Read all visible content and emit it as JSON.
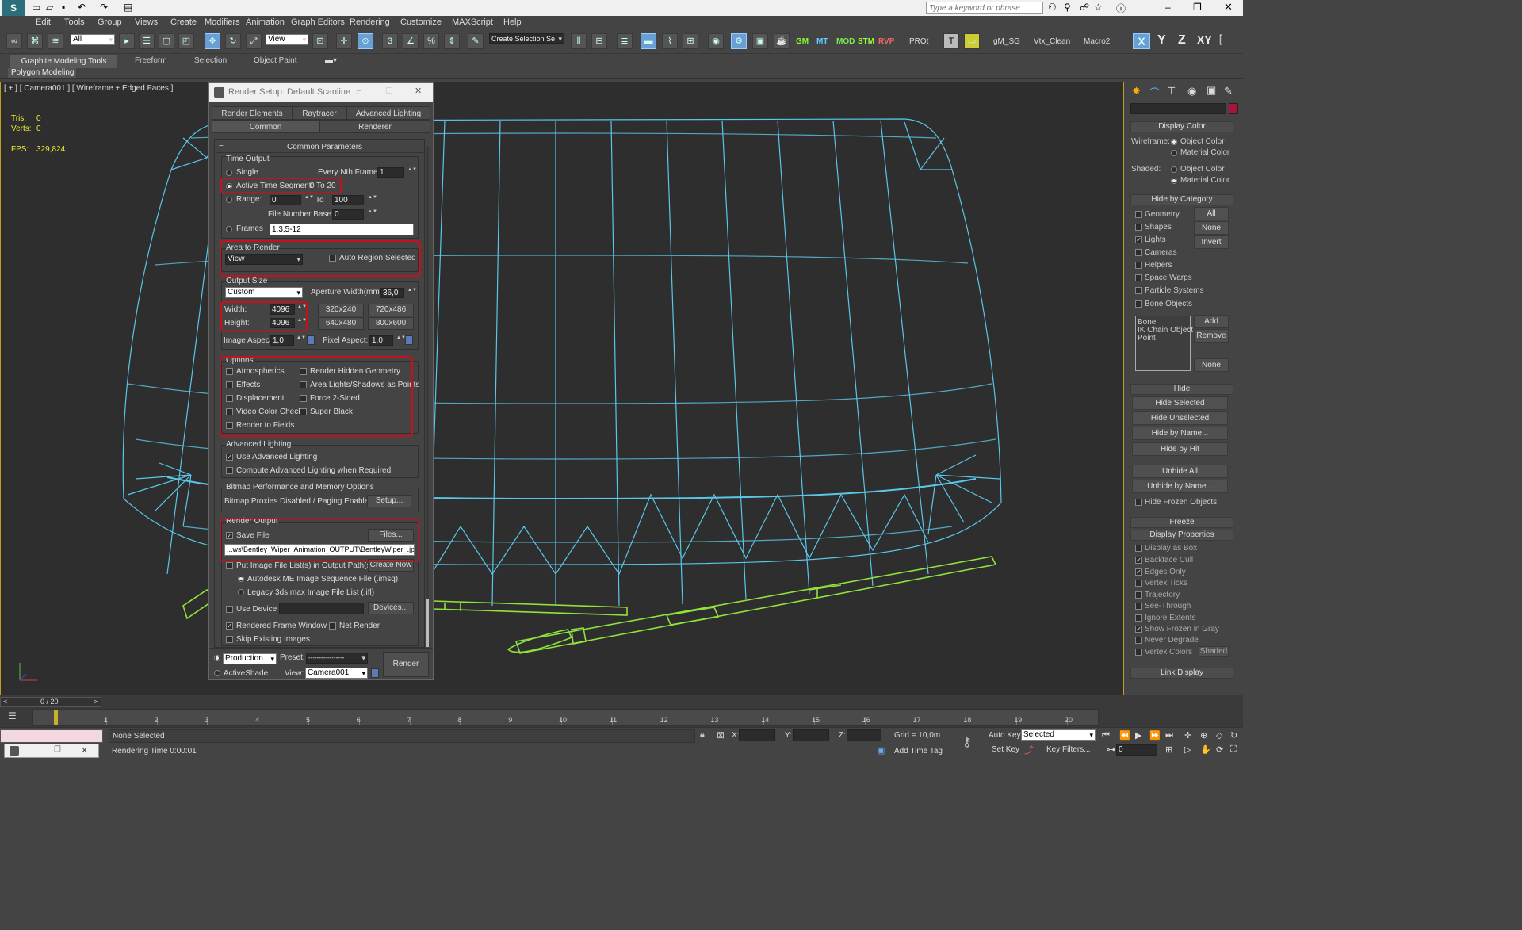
{
  "title_bar": {
    "search_placeholder": "Type a keyword or phrase"
  },
  "menu": [
    "Edit",
    "Tools",
    "Group",
    "Views",
    "Create",
    "Modifiers",
    "Animation",
    "Graph Editors",
    "Rendering",
    "Customize",
    "MAXScript",
    "Help"
  ],
  "toolbar": {
    "selection_filter": "All",
    "ref_coord": "View",
    "named_selection": "Create Selection Se",
    "script_labels": [
      "GM",
      "MT",
      "MOD",
      "STM",
      "RVP",
      "PROt",
      "gM_SG",
      "Vtx_Clean",
      "Macro2"
    ],
    "axis_labels": [
      "X",
      "Y",
      "Z",
      "XY"
    ]
  },
  "ribbon": {
    "tabs": [
      "Graphite Modeling Tools",
      "Freeform",
      "Selection",
      "Object Paint"
    ],
    "sub_label": "Polygon Modeling"
  },
  "viewport": {
    "label": "[ + ] [ Camera001 ] [ Wireframe + Edged Faces ]",
    "stats": {
      "tris_label": "Tris:",
      "tris": "0",
      "verts_label": "Verts:",
      "verts": "0",
      "fps_label": "FPS:",
      "fps": "329,824"
    },
    "colors": {
      "wire": "#5ac6e8",
      "wiper": "#8fe33c",
      "bg": "#2e2e2e"
    }
  },
  "dialog": {
    "title": "Render Setup: Default Scanline ...",
    "tabs_row1": [
      "Render Elements",
      "Raytracer",
      "Advanced Lighting"
    ],
    "tabs_row2": [
      "Common",
      "Renderer"
    ],
    "rollout": "Common Parameters",
    "time_output": {
      "label": "Time Output",
      "single": "Single",
      "every_nth_label": "Every Nth Frame:",
      "every_nth": "1",
      "active_segment": "Active Time Segment:",
      "active_segment_value": "0 To 20",
      "range": "Range:",
      "range_from": "0",
      "to": "To",
      "range_to": "100",
      "file_number_base_label": "File Number Base:",
      "file_number_base": "0",
      "frames": "Frames",
      "frames_value": "1,3,5-12"
    },
    "area": {
      "label": "Area to Render",
      "value": "View",
      "auto_region": "Auto Region Selected"
    },
    "output_size": {
      "label": "Output Size",
      "preset": "Custom",
      "aperture_label": "Aperture Width(mm):",
      "aperture": "36,0",
      "width_label": "Width:",
      "width": "4096",
      "height_label": "Height:",
      "height": "4096",
      "presets": [
        "320x240",
        "720x486",
        "640x480",
        "800x600"
      ],
      "image_aspect_label": "Image Aspect:",
      "image_aspect": "1,0",
      "pixel_aspect_label": "Pixel Aspect:",
      "pixel_aspect": "1,0"
    },
    "options": {
      "label": "Options",
      "left": [
        "Atmospherics",
        "Effects",
        "Displacement",
        "Video Color Check",
        "Render to Fields"
      ],
      "right": [
        "Render Hidden Geometry",
        "Area Lights/Shadows as Points",
        "Force 2-Sided",
        "Super Black"
      ]
    },
    "advanced_lighting": {
      "label": "Advanced Lighting",
      "use": "Use Advanced Lighting",
      "compute": "Compute Advanced Lighting when Required"
    },
    "bitmap": {
      "label": "Bitmap Performance and Memory Options",
      "status": "Bitmap Proxies Disabled / Paging Enabled",
      "setup": "Setup..."
    },
    "render_output": {
      "label": "Render Output",
      "save_file": "Save File",
      "files_btn": "Files...",
      "path": "...ws\\Bentley_Wiper_Animation_OUTPUT\\BentleyWiper_.jpg",
      "put_image": "Put Image File List(s) in Output Path(s)",
      "create_now": "Create Now",
      "autodesk_me": "Autodesk ME Image Sequence File (.imsq)",
      "legacy": "Legacy 3ds max Image File List (.ifl)",
      "use_device": "Use Device",
      "devices": "Devices...",
      "rendered_frame": "Rendered Frame Window",
      "net_render": "Net Render",
      "skip_existing": "Skip Existing Images"
    },
    "footer": {
      "production": "Production",
      "preset_label": "Preset:",
      "preset_value": "-----------------",
      "activeshade": "ActiveShade",
      "view_label": "View:",
      "view_value": "Camera001",
      "render": "Render"
    }
  },
  "right_panel": {
    "display_color": {
      "title": "Display Color",
      "wireframe": "Wireframe:",
      "shaded": "Shaded:",
      "object_color": "Object Color",
      "material_color": "Material Color"
    },
    "hide_by_category": {
      "title": "Hide by Category",
      "items": [
        "Geometry",
        "Shapes",
        "Lights",
        "Cameras",
        "Helpers",
        "Space Warps",
        "Particle Systems",
        "Bone Objects"
      ],
      "buttons": [
        "All",
        "None",
        "Invert"
      ],
      "list": [
        "Bone",
        "IK Chain Object",
        "Point"
      ],
      "list_buttons": [
        "Add",
        "Remove",
        "None"
      ]
    },
    "hide": {
      "title": "Hide",
      "buttons": [
        "Hide Selected",
        "Hide Unselected",
        "Hide by Name...",
        "Hide by Hit",
        "Unhide All",
        "Unhide by Name..."
      ],
      "hide_frozen": "Hide Frozen Objects"
    },
    "freeze_title": "Freeze",
    "display_properties": {
      "title": "Display Properties",
      "items": [
        "Display as Box",
        "Backface Cull",
        "Edges Only",
        "Vertex Ticks",
        "Trajectory",
        "See-Through",
        "Ignore Extents",
        "Show Frozen in Gray",
        "Never Degrade",
        "Vertex Colors"
      ],
      "shaded_btn": "Shaded"
    },
    "link_display": "Link Display"
  },
  "timeline": {
    "frame_label": "0 / 20",
    "ticks": [
      "1",
      "2",
      "3",
      "4",
      "5",
      "6",
      "7",
      "8",
      "9",
      "10",
      "11",
      "12",
      "13",
      "14",
      "15",
      "16",
      "17",
      "18",
      "19",
      "20"
    ]
  },
  "status": {
    "selection": "None Selected",
    "rendering_time": "Rendering Time  0:00:01",
    "x_label": "X:",
    "y_label": "Y:",
    "z_label": "Z:",
    "grid": "Grid = 10,0m",
    "add_time_tag": "Add Time Tag",
    "auto_key": "Auto Key",
    "auto_key_mode": "Selected",
    "set_key": "Set Key",
    "key_filters": "Key Filters...",
    "current_frame": "0"
  }
}
